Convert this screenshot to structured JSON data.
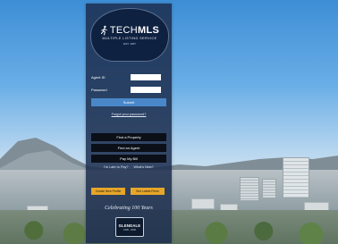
{
  "brand": {
    "name_bold": "TECH",
    "name_light": "MLS",
    "tagline": "MULTIPLE LISTING SERVICE",
    "established": "EST. 1957"
  },
  "login": {
    "agent_id_label": "Agent ID",
    "agent_id_value": "",
    "password_label": "Password",
    "password_value": "",
    "submit_label": "Submit",
    "forgot_password": "Forgot your password?"
  },
  "actions": {
    "find_property": "Find a Property",
    "find_agent": "Find an Agent",
    "pay_bill": "Pay My Bill",
    "late_to_pay": "I'm Late to Pay?",
    "whats_new": "What's New?"
  },
  "secondary": {
    "left_label": "Create New Profile",
    "right_label": "See Latest Firms"
  },
  "celebration": {
    "text": "Celebrating 100 Years",
    "badge_title": "GLENDALE",
    "badge_subtitle": "1906 - 2006"
  },
  "colors": {
    "panel": "#1c2d4e",
    "submit": "#4a87c9",
    "gold": "#e7a629",
    "dark_button": "#0b0f18"
  }
}
